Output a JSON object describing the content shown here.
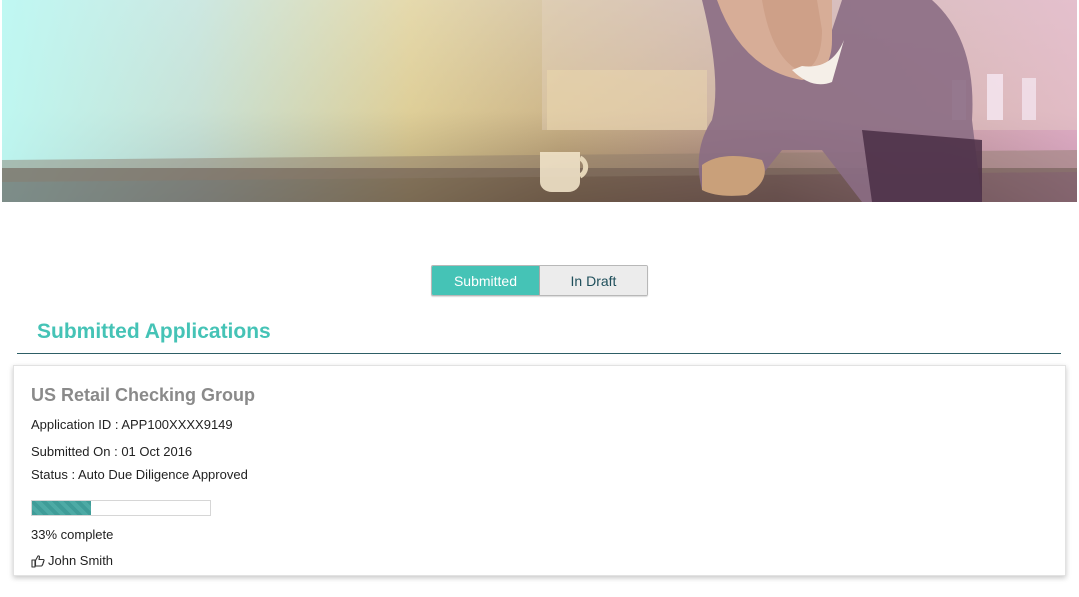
{
  "hero": {
    "image": "person-leaning-on-kitchen-counter-photo"
  },
  "tabs": [
    {
      "label": "Submitted",
      "active": true
    },
    {
      "label": "In Draft",
      "active": false
    }
  ],
  "section": {
    "title": "Submitted Applications"
  },
  "application": {
    "title": "US Retail Checking Group",
    "application_id": "Application ID : APP100XXXX9149",
    "submitted_on": "Submitted On : 01 Oct 2016",
    "status": "Status : Auto Due Diligence Approved",
    "progress": 0.33,
    "progress_text": "33% complete",
    "user_icon": "hand-point-right-icon",
    "user": "John Smith"
  },
  "colors": {
    "accent": "#45c3b6",
    "rule": "#2e5f66",
    "progress": "#3f9c98"
  }
}
